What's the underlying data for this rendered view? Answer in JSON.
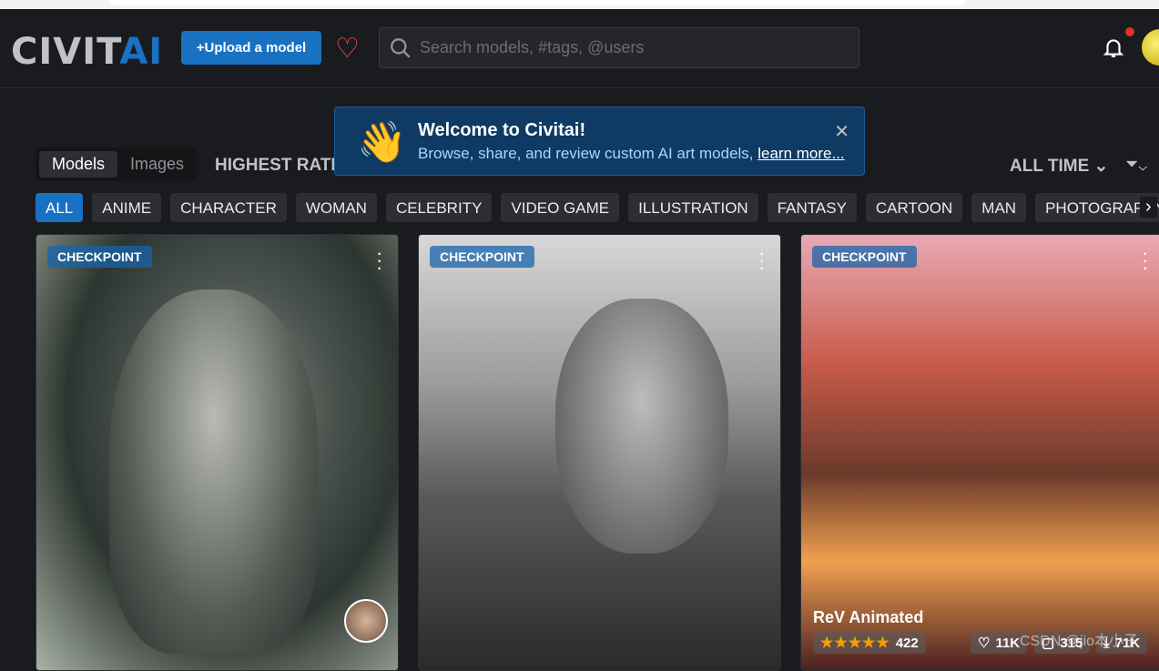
{
  "header": {
    "logo": {
      "part1": "CIVIT",
      "part2": "AI"
    },
    "upload_label": "Upload a model",
    "search_placeholder": "Search models, #tags, @users"
  },
  "toast": {
    "title": "Welcome to Civitai!",
    "text": "Browse, share, and review custom AI art models, ",
    "link": "learn more..."
  },
  "toolbar": {
    "segments": [
      "Models",
      "Images"
    ],
    "active_segment": "Models",
    "sort": "HIGHEST RATED",
    "period": "ALL TIME"
  },
  "tags": [
    "ALL",
    "ANIME",
    "CHARACTER",
    "WOMAN",
    "CELEBRITY",
    "VIDEO GAME",
    "ILLUSTRATION",
    "FANTASY",
    "CARTOON",
    "MAN",
    "PHOTOGRAPHY"
  ],
  "active_tag": "ALL",
  "cards": [
    {
      "badge": "CHECKPOINT"
    },
    {
      "badge": "CHECKPOINT"
    },
    {
      "badge": "CHECKPOINT",
      "title": "ReV Animated",
      "rating": 5,
      "reviews": "422",
      "likes": "11K",
      "comments": "315",
      "downloads": "71K"
    }
  ],
  "colors": {
    "accent": "#1971c2",
    "heart": "#fa5252",
    "star": "#f59f00"
  },
  "watermark": "CSDN @jio本小子"
}
